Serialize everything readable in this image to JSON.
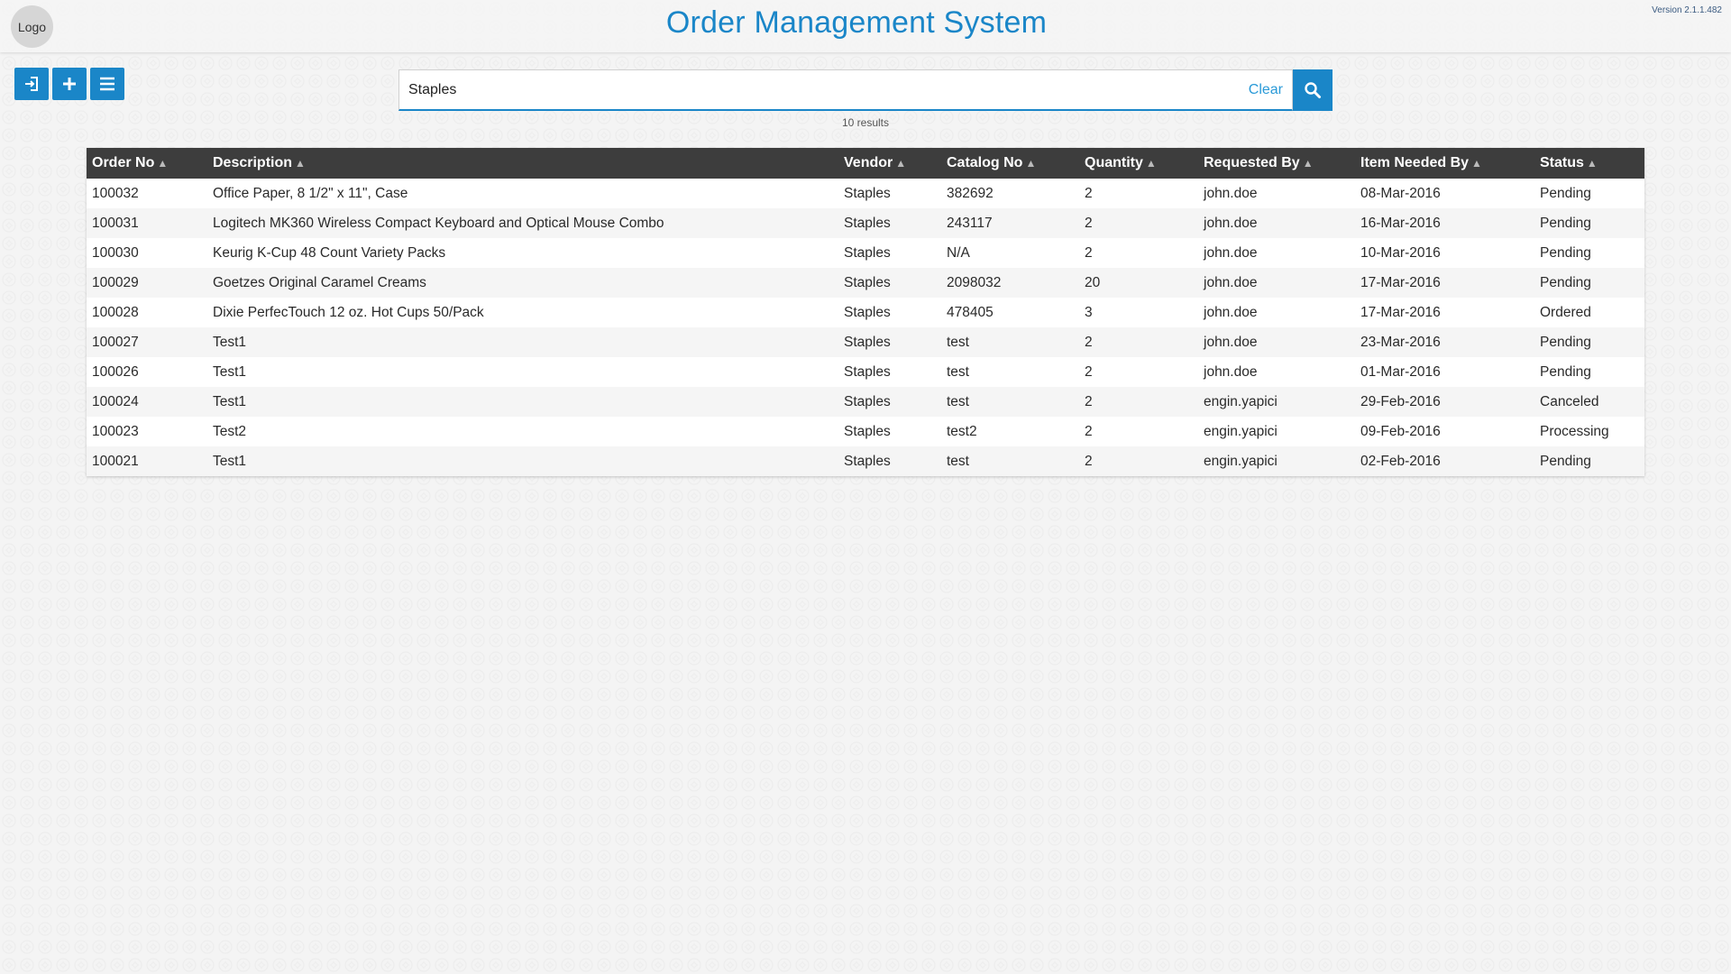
{
  "header": {
    "logo_label": "Logo",
    "title": "Order Management System",
    "version": "Version 2.1.1.482"
  },
  "toolbar": {
    "buttons": [
      {
        "icon": "sign-in-icon"
      },
      {
        "icon": "plus-icon"
      },
      {
        "icon": "menu-icon"
      }
    ]
  },
  "search": {
    "value": "Staples",
    "clear_label": "Clear",
    "results_text": "10 results"
  },
  "table": {
    "columns": [
      "Order No",
      "Description",
      "Vendor",
      "Catalog No",
      "Quantity",
      "Requested By",
      "Item Needed By",
      "Status"
    ],
    "rows": [
      [
        "100032",
        "Office Paper, 8 1/2\" x 11\", Case",
        "Staples",
        "382692",
        "2",
        "john.doe",
        "08-Mar-2016",
        "Pending"
      ],
      [
        "100031",
        "Logitech MK360 Wireless Compact Keyboard and Optical Mouse Combo",
        "Staples",
        "243117",
        "2",
        "john.doe",
        "16-Mar-2016",
        "Pending"
      ],
      [
        "100030",
        "Keurig K-Cup 48 Count Variety Packs",
        "Staples",
        "N/A",
        "2",
        "john.doe",
        "10-Mar-2016",
        "Pending"
      ],
      [
        "100029",
        "Goetzes Original Caramel Creams",
        "Staples",
        "2098032",
        "20",
        "john.doe",
        "17-Mar-2016",
        "Pending"
      ],
      [
        "100028",
        "Dixie PerfecTouch 12 oz. Hot Cups 50/Pack",
        "Staples",
        "478405",
        "3",
        "john.doe",
        "17-Mar-2016",
        "Ordered"
      ],
      [
        "100027",
        "Test1",
        "Staples",
        "test",
        "2",
        "john.doe",
        "23-Mar-2016",
        "Pending"
      ],
      [
        "100026",
        "Test1",
        "Staples",
        "test",
        "2",
        "john.doe",
        "01-Mar-2016",
        "Pending"
      ],
      [
        "100024",
        "Test1",
        "Staples",
        "test",
        "2",
        "engin.yapici",
        "29-Feb-2016",
        "Canceled"
      ],
      [
        "100023",
        "Test2",
        "Staples",
        "test2",
        "2",
        "engin.yapici",
        "09-Feb-2016",
        "Processing"
      ],
      [
        "100021",
        "Test1",
        "Staples",
        "test",
        "2",
        "engin.yapici",
        "02-Feb-2016",
        "Pending"
      ]
    ]
  },
  "colors": {
    "accent": "#1a86c8",
    "header_row": "#3d3d3d"
  }
}
